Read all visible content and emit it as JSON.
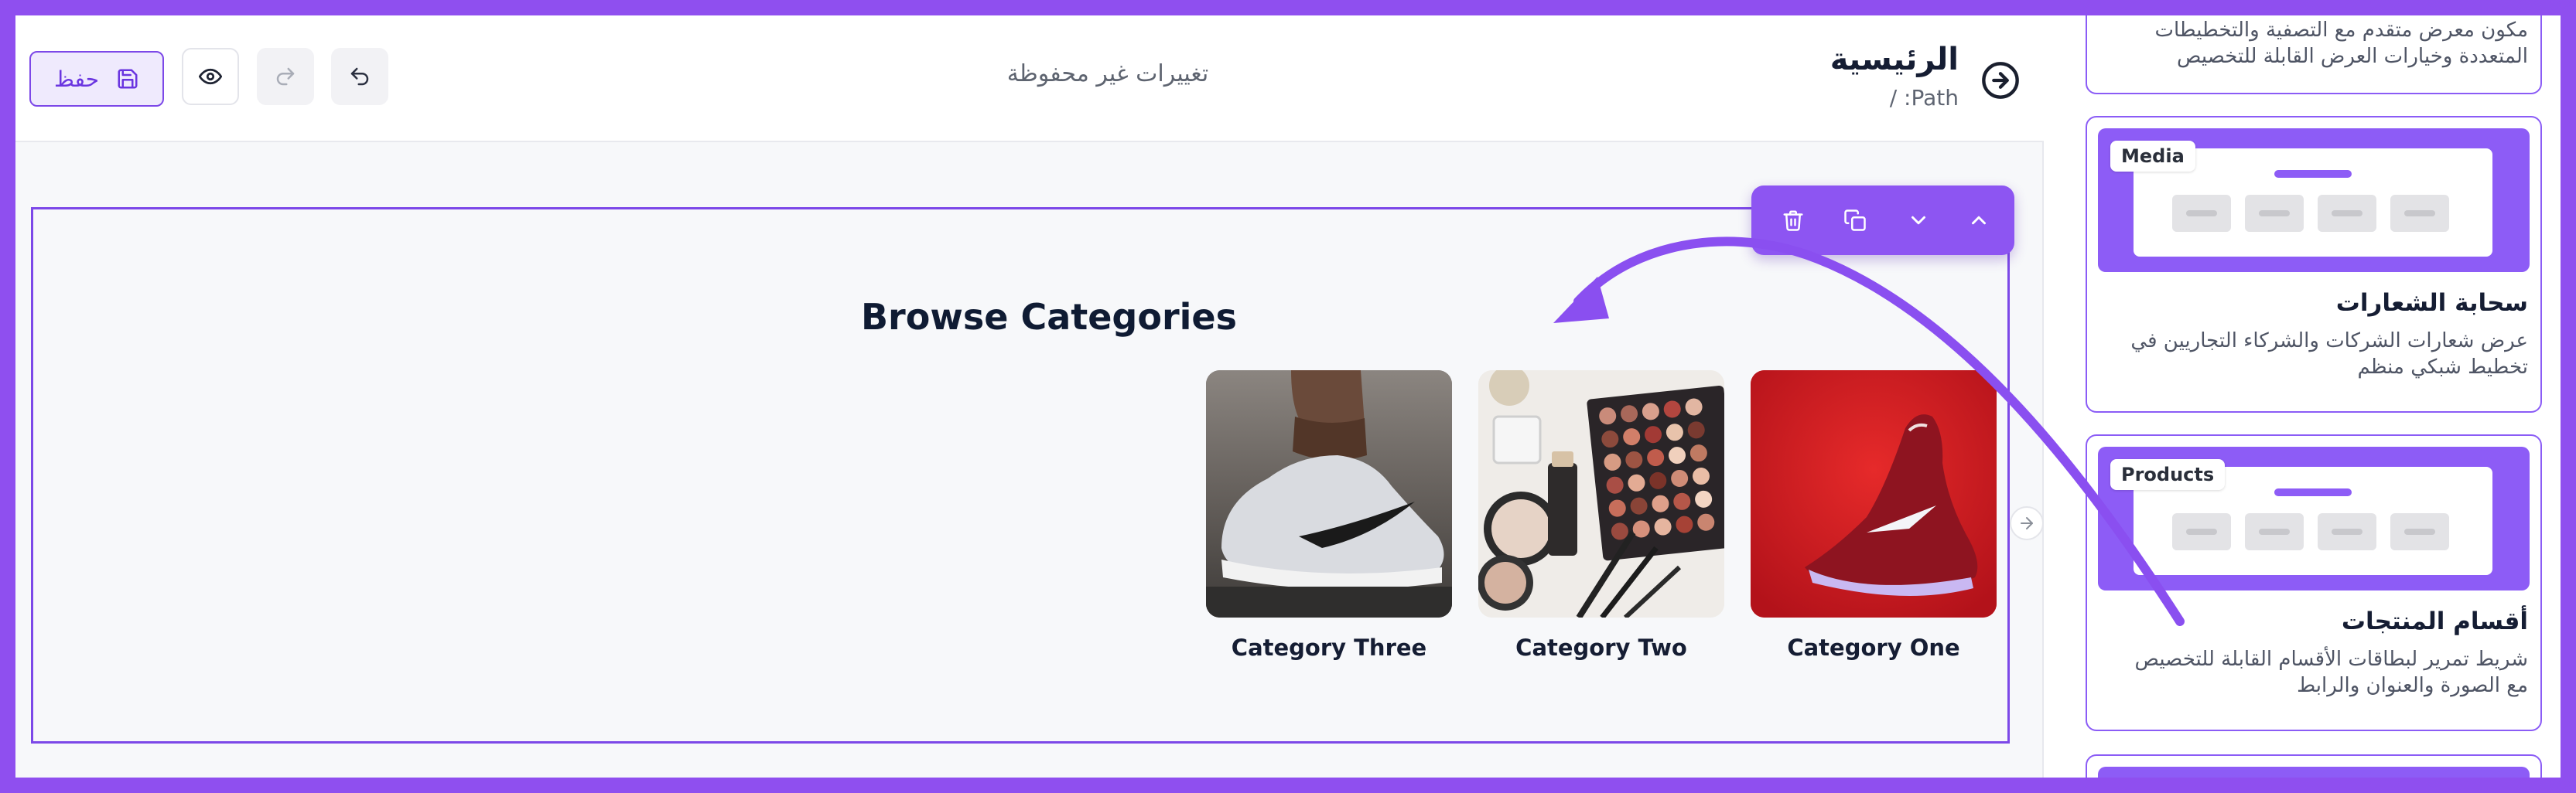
{
  "header": {
    "title": "الرئيسية",
    "path": "Path: /",
    "status": "تغييرات غير محفوظة",
    "save_label": "حفظ"
  },
  "section": {
    "title": "Browse Categories",
    "categories": [
      {
        "label": "Category One"
      },
      {
        "label": "Category Two"
      },
      {
        "label": "Category Three"
      }
    ]
  },
  "panel": {
    "blocks": [
      {
        "description": "مكون معرض متقدم مع التصفية والتخطيطات المتعددة وخيارات العرض القابلة للتخصيص"
      },
      {
        "tag": "Media",
        "title": "سحابة الشعارات",
        "description": "عرض شعارات الشركات والشركاء التجاريين في تخطيط شبكي منظم"
      },
      {
        "tag": "Products",
        "title": "أقسام المنتجات",
        "description": "شريط تمرير لبطاقات الأقسام القابلة للتخصيص مع الصورة والعنوان والرابط"
      }
    ]
  },
  "colors": {
    "accent": "#8f4fef",
    "selection_border": "#7c48e8",
    "text_dark": "#151d33"
  }
}
